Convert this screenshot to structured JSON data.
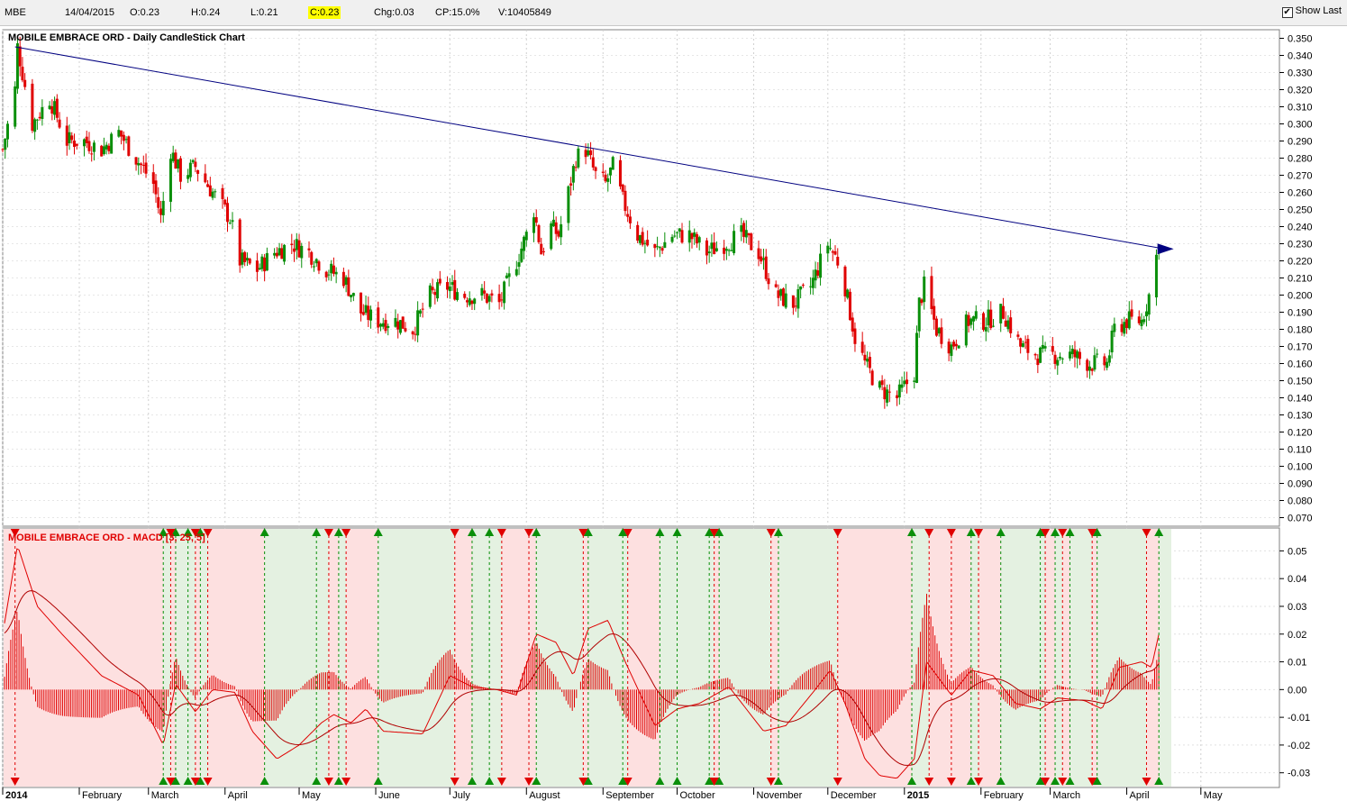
{
  "header": {
    "symbol": "MBE",
    "date": "14/04/2015",
    "open": "O:0.23",
    "high": "H:0.24",
    "low": "L:0.21",
    "close": "C:0.23",
    "change": "Chg:0.03",
    "cp": "CP:15.0%",
    "volume": "V:10405849",
    "show_last_label": "Show Last",
    "show_last_checked": true
  },
  "colors": {
    "up": "#0a8f0a",
    "down": "#e00000",
    "trendline": "#000080",
    "bull_zone": "#e4f1e1",
    "bear_zone": "#fde0e0",
    "macd_title": "#e00000"
  },
  "chart_data": [
    {
      "type": "candlestick",
      "title": "MOBILE EMBRACE ORD - Daily CandleStick Chart",
      "ylim": [
        0.065,
        0.355
      ],
      "y_ticks": [
        "0.070",
        "0.080",
        "0.090",
        "0.100",
        "0.110",
        "0.120",
        "0.130",
        "0.140",
        "0.150",
        "0.160",
        "0.170",
        "0.180",
        "0.190",
        "0.200",
        "0.210",
        "0.220",
        "0.230",
        "0.240",
        "0.250",
        "0.260",
        "0.270",
        "0.280",
        "0.290",
        "0.300",
        "0.310",
        "0.320",
        "0.330",
        "0.340",
        "0.350"
      ],
      "x_labels": [
        "2014",
        "February",
        "March",
        "April",
        "May",
        "June",
        "July",
        "August",
        "September",
        "October",
        "November",
        "December",
        "2015",
        "February",
        "March",
        "April",
        "May"
      ],
      "bold_x_labels": [
        "2014",
        "2015"
      ],
      "trend_line": {
        "start": {
          "x": "2014-01-06",
          "y": 0.345
        },
        "end": {
          "x": "2015-04-20",
          "y": 0.227
        },
        "arrow": true
      },
      "price_path": [
        [
          "2014-01-01",
          0.285
        ],
        [
          "2014-01-06",
          0.32
        ],
        [
          "2014-01-07",
          0.345
        ],
        [
          "2014-01-13",
          0.3
        ],
        [
          "2014-01-20",
          0.315
        ],
        [
          "2014-01-27",
          0.29
        ],
        [
          "2014-02-03",
          0.29
        ],
        [
          "2014-02-10",
          0.285
        ],
        [
          "2014-02-17",
          0.295
        ],
        [
          "2014-02-24",
          0.28
        ],
        [
          "2014-03-03",
          0.265
        ],
        [
          "2014-03-06",
          0.245
        ],
        [
          "2014-03-10",
          0.285
        ],
        [
          "2014-03-14",
          0.27
        ],
        [
          "2014-03-20",
          0.275
        ],
        [
          "2014-03-27",
          0.26
        ],
        [
          "2014-04-03",
          0.245
        ],
        [
          "2014-04-07",
          0.22
        ],
        [
          "2014-04-14",
          0.215
        ],
        [
          "2014-04-21",
          0.225
        ],
        [
          "2014-04-28",
          0.23
        ],
        [
          "2014-05-05",
          0.225
        ],
        [
          "2014-05-12",
          0.215
        ],
        [
          "2014-05-19",
          0.21
        ],
        [
          "2014-05-26",
          0.19
        ],
        [
          "2014-06-02",
          0.185
        ],
        [
          "2014-06-09",
          0.185
        ],
        [
          "2014-06-16",
          0.18
        ],
        [
          "2014-06-23",
          0.2
        ],
        [
          "2014-06-30",
          0.205
        ],
        [
          "2014-07-07",
          0.2
        ],
        [
          "2014-07-14",
          0.2
        ],
        [
          "2014-07-21",
          0.195
        ],
        [
          "2014-07-28",
          0.22
        ],
        [
          "2014-08-01",
          0.235
        ],
        [
          "2014-08-04",
          0.25
        ],
        [
          "2014-08-07",
          0.225
        ],
        [
          "2014-08-11",
          0.24
        ],
        [
          "2014-08-14",
          0.235
        ],
        [
          "2014-08-18",
          0.26
        ],
        [
          "2014-08-21",
          0.28
        ],
        [
          "2014-08-25",
          0.285
        ],
        [
          "2014-08-29",
          0.27
        ],
        [
          "2014-09-02",
          0.265
        ],
        [
          "2014-09-05",
          0.275
        ],
        [
          "2014-09-09",
          0.255
        ],
        [
          "2014-09-15",
          0.235
        ],
        [
          "2014-09-22",
          0.225
        ],
        [
          "2014-09-29",
          0.235
        ],
        [
          "2014-10-06",
          0.235
        ],
        [
          "2014-10-13",
          0.225
        ],
        [
          "2014-10-20",
          0.23
        ],
        [
          "2014-10-27",
          0.235
        ],
        [
          "2014-11-03",
          0.225
        ],
        [
          "2014-11-10",
          0.2
        ],
        [
          "2014-11-17",
          0.195
        ],
        [
          "2014-11-24",
          0.205
        ],
        [
          "2014-12-01",
          0.23
        ],
        [
          "2014-12-05",
          0.22
        ],
        [
          "2014-12-08",
          0.205
        ],
        [
          "2014-12-12",
          0.175
        ],
        [
          "2014-12-16",
          0.16
        ],
        [
          "2014-12-22",
          0.145
        ],
        [
          "2014-12-29",
          0.14
        ],
        [
          "2015-01-05",
          0.155
        ],
        [
          "2015-01-07",
          0.195
        ],
        [
          "2015-01-09",
          0.205
        ],
        [
          "2015-01-14",
          0.18
        ],
        [
          "2015-01-20",
          0.17
        ],
        [
          "2015-01-27",
          0.185
        ],
        [
          "2015-02-03",
          0.185
        ],
        [
          "2015-02-10",
          0.19
        ],
        [
          "2015-02-17",
          0.17
        ],
        [
          "2015-02-24",
          0.165
        ],
        [
          "2015-03-03",
          0.165
        ],
        [
          "2015-03-10",
          0.165
        ],
        [
          "2015-03-17",
          0.16
        ],
        [
          "2015-03-24",
          0.16
        ],
        [
          "2015-03-27",
          0.18
        ],
        [
          "2015-04-01",
          0.185
        ],
        [
          "2015-04-07",
          0.185
        ],
        [
          "2015-04-10",
          0.2
        ],
        [
          "2015-04-14",
          0.23
        ]
      ]
    },
    {
      "type": "line",
      "title": "MOBILE EMBRACE ORD - MACD [3, 25, 5]",
      "ylim": [
        -0.034,
        0.055
      ],
      "y_ticks": [
        "0.05",
        "0.04",
        "0.03",
        "0.02",
        "0.01",
        "0.00",
        "-0.01",
        "-0.02",
        "-0.03"
      ],
      "macd_path": [
        [
          "2014-01-01",
          0.02
        ],
        [
          "2014-01-07",
          0.052
        ],
        [
          "2014-01-15",
          0.03
        ],
        [
          "2014-01-25",
          0.02
        ],
        [
          "2014-02-10",
          0.005
        ],
        [
          "2014-02-25",
          -0.002
        ],
        [
          "2014-03-07",
          -0.02
        ],
        [
          "2014-03-12",
          0.002
        ],
        [
          "2014-03-20",
          -0.008
        ],
        [
          "2014-03-27",
          0.0
        ],
        [
          "2014-04-05",
          -0.001
        ],
        [
          "2014-04-12",
          -0.015
        ],
        [
          "2014-04-22",
          -0.025
        ],
        [
          "2014-05-01",
          -0.02
        ],
        [
          "2014-05-10",
          -0.012
        ],
        [
          "2014-05-15",
          -0.009
        ],
        [
          "2014-05-22",
          -0.012
        ],
        [
          "2014-05-28",
          -0.007
        ],
        [
          "2014-06-04",
          -0.015
        ],
        [
          "2014-06-20",
          -0.016
        ],
        [
          "2014-07-01",
          0.005
        ],
        [
          "2014-07-10",
          0.001
        ],
        [
          "2014-07-20",
          0.0
        ],
        [
          "2014-07-28",
          -0.002
        ],
        [
          "2014-08-05",
          0.02
        ],
        [
          "2014-08-13",
          0.017
        ],
        [
          "2014-08-20",
          0.005
        ],
        [
          "2014-08-26",
          0.022
        ],
        [
          "2014-09-03",
          0.025
        ],
        [
          "2014-09-10",
          0.01
        ],
        [
          "2014-09-22",
          -0.013
        ],
        [
          "2014-10-01",
          -0.007
        ],
        [
          "2014-10-10",
          -0.005
        ],
        [
          "2014-10-22",
          0.001
        ],
        [
          "2014-11-05",
          -0.015
        ],
        [
          "2014-11-14",
          -0.013
        ],
        [
          "2014-11-25",
          -0.001
        ],
        [
          "2014-12-02",
          0.007
        ],
        [
          "2014-12-08",
          -0.005
        ],
        [
          "2014-12-16",
          -0.025
        ],
        [
          "2014-12-22",
          -0.031
        ],
        [
          "2014-12-29",
          -0.032
        ],
        [
          "2015-01-05",
          -0.025
        ],
        [
          "2015-01-10",
          0.01
        ],
        [
          "2015-01-20",
          -0.002
        ],
        [
          "2015-01-28",
          0.007
        ],
        [
          "2015-02-06",
          0.005
        ],
        [
          "2015-02-15",
          -0.005
        ],
        [
          "2015-02-25",
          -0.007
        ],
        [
          "2015-03-04",
          -0.003
        ],
        [
          "2015-03-15",
          -0.004
        ],
        [
          "2015-03-22",
          -0.007
        ],
        [
          "2015-03-29",
          0.008
        ],
        [
          "2015-04-07",
          0.01
        ],
        [
          "2015-04-11",
          0.008
        ],
        [
          "2015-04-14",
          0.02
        ]
      ],
      "signal_cross_dates_up": [
        "2014-03-07",
        "2014-03-12",
        "2014-03-17",
        "2014-03-22",
        "2014-04-17",
        "2014-05-08",
        "2014-05-17",
        "2014-06-02",
        "2014-07-10",
        "2014-07-17",
        "2014-08-05",
        "2014-08-26",
        "2014-09-09",
        "2014-09-24",
        "2014-10-01",
        "2014-10-14",
        "2014-10-18",
        "2014-11-11",
        "2015-01-04",
        "2015-01-28",
        "2015-02-09",
        "2015-02-25",
        "2015-03-03",
        "2015-03-09",
        "2015-03-20",
        "2015-04-14"
      ],
      "signal_cross_dates_down": [
        "2014-01-06",
        "2014-03-10",
        "2014-03-20",
        "2014-03-25",
        "2014-05-13",
        "2014-05-20",
        "2014-07-03",
        "2014-07-22",
        "2014-08-02",
        "2014-08-24",
        "2014-09-11",
        "2014-10-16",
        "2014-11-08",
        "2014-12-05",
        "2015-01-11",
        "2015-01-20",
        "2015-01-31",
        "2015-02-27",
        "2015-03-06",
        "2015-03-18",
        "2015-04-09"
      ]
    }
  ]
}
